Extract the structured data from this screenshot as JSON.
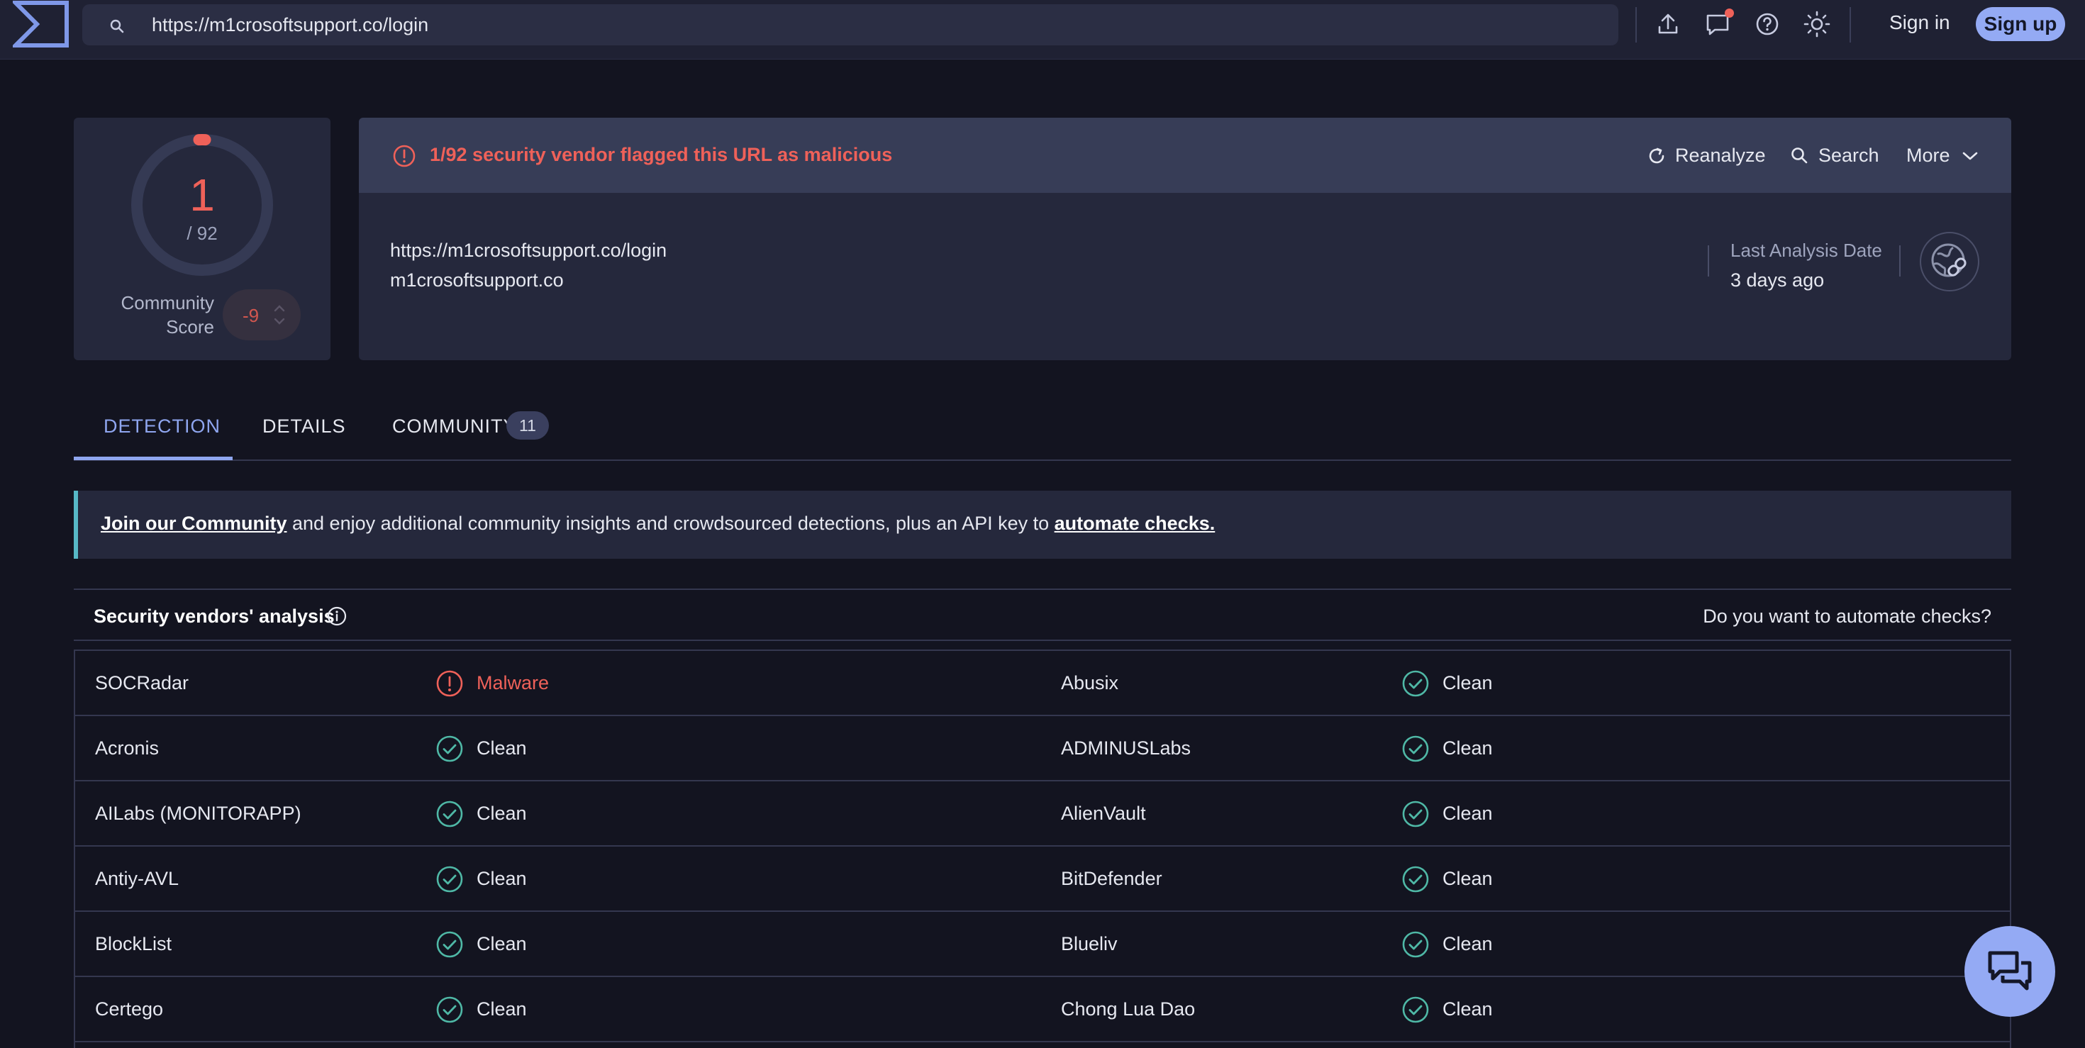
{
  "topbar": {
    "url": "https://m1crosoftsupport.co/login",
    "icons": [
      "upload-icon",
      "chat-bubble-icon",
      "help-icon",
      "sun-icon"
    ],
    "sign_in": "Sign in",
    "sign_up": "Sign up"
  },
  "score": {
    "malicious": "1",
    "total": "/ 92",
    "community_label": "Community Score",
    "community_value": "-9"
  },
  "alert": {
    "text": "1/92 security vendor flagged this URL as malicious",
    "reanalyze": "Reanalyze",
    "search": "Search",
    "more": "More"
  },
  "target": {
    "url": "https://m1crosoftsupport.co/login",
    "domain": "m1crosoftsupport.co",
    "last_analysis_label": "Last Analysis Date",
    "last_analysis_value": "3 days ago"
  },
  "tabs": [
    {
      "label": "DETECTION"
    },
    {
      "label": "DETAILS"
    },
    {
      "label": "COMMUNITY",
      "badge": "11"
    }
  ],
  "banner": {
    "link1": "Join our Community",
    "middle": " and enjoy additional community insights and crowdsourced detections, plus an API key to ",
    "link2": "automate checks."
  },
  "vendors": {
    "title": "Security vendors' analysis",
    "automate": "Do you want to automate checks?",
    "rows": [
      {
        "left": {
          "name": "SOCRadar",
          "result": "Malware"
        },
        "right": {
          "name": "Abusix",
          "result": "Clean"
        }
      },
      {
        "left": {
          "name": "Acronis",
          "result": "Clean"
        },
        "right": {
          "name": "ADMINUSLabs",
          "result": "Clean"
        }
      },
      {
        "left": {
          "name": "AILabs (MONITORAPP)",
          "result": "Clean"
        },
        "right": {
          "name": "AlienVault",
          "result": "Clean"
        }
      },
      {
        "left": {
          "name": "Antiy-AVL",
          "result": "Clean"
        },
        "right": {
          "name": "BitDefender",
          "result": "Clean"
        }
      },
      {
        "left": {
          "name": "BlockList",
          "result": "Clean"
        },
        "right": {
          "name": "Blueliv",
          "result": "Clean"
        }
      },
      {
        "left": {
          "name": "Certego",
          "result": "Clean"
        },
        "right": {
          "name": "Chong Lua Dao",
          "result": "Clean"
        }
      }
    ]
  },
  "colors": {
    "accent": "#8fa6ef",
    "malicious": "#ef6159",
    "clean": "#4fb8a6"
  }
}
